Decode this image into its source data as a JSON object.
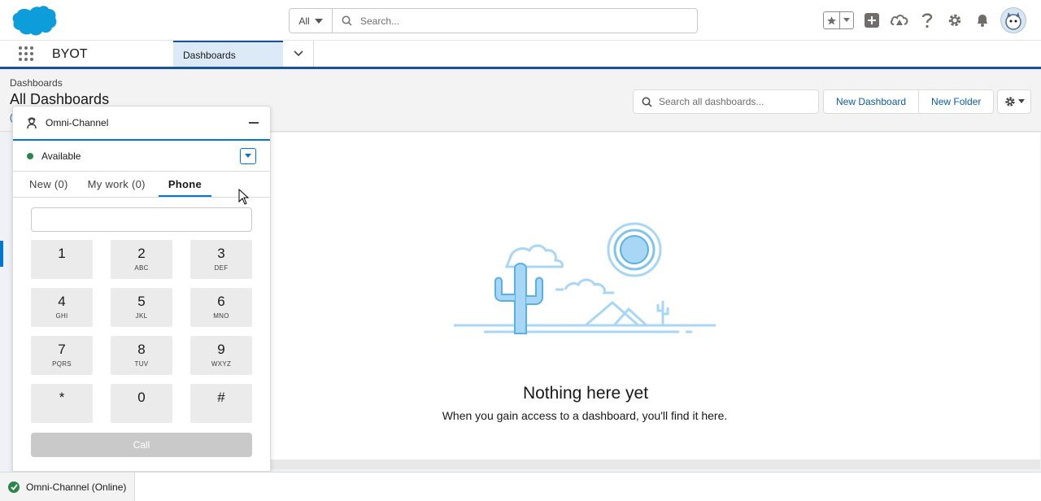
{
  "global_header": {
    "search_scope": "All",
    "search_placeholder": "Search..."
  },
  "app_nav": {
    "app_name": "BYOT",
    "tabs": [
      {
        "label": "Dashboards",
        "active": true
      }
    ]
  },
  "page": {
    "breadcrumb": "Dashboards",
    "title": "All Dashboards",
    "search_placeholder": "Search all dashboards...",
    "buttons": {
      "new_dashboard": "New Dashboard",
      "new_folder": "New Folder"
    }
  },
  "empty_state": {
    "title": "Nothing here yet",
    "subtitle": "When you gain access to a dashboard, you'll find it here."
  },
  "omni_channel": {
    "title": "Omni-Channel",
    "status": "Available",
    "status_color": "#2e844a",
    "tabs": [
      {
        "label": "New (0)"
      },
      {
        "label": "My work (0)"
      },
      {
        "label": "Phone",
        "active": true
      }
    ],
    "keypad": [
      {
        "num": "1",
        "letters": ""
      },
      {
        "num": "2",
        "letters": "ABC"
      },
      {
        "num": "3",
        "letters": "DEF"
      },
      {
        "num": "4",
        "letters": "GHI"
      },
      {
        "num": "5",
        "letters": "JKL"
      },
      {
        "num": "6",
        "letters": "MNO"
      },
      {
        "num": "7",
        "letters": "PQRS"
      },
      {
        "num": "8",
        "letters": "TUV"
      },
      {
        "num": "9",
        "letters": "WXYZ"
      },
      {
        "num": "*",
        "letters": ""
      },
      {
        "num": "0",
        "letters": ""
      },
      {
        "num": "#",
        "letters": ""
      }
    ],
    "call_label": "Call"
  },
  "utility_bar": {
    "item_label": "Omni-Channel (Online)"
  },
  "colors": {
    "brand": "#1b5297",
    "accent": "#0176d3",
    "link": "#0b5cab",
    "online": "#2e844a"
  }
}
